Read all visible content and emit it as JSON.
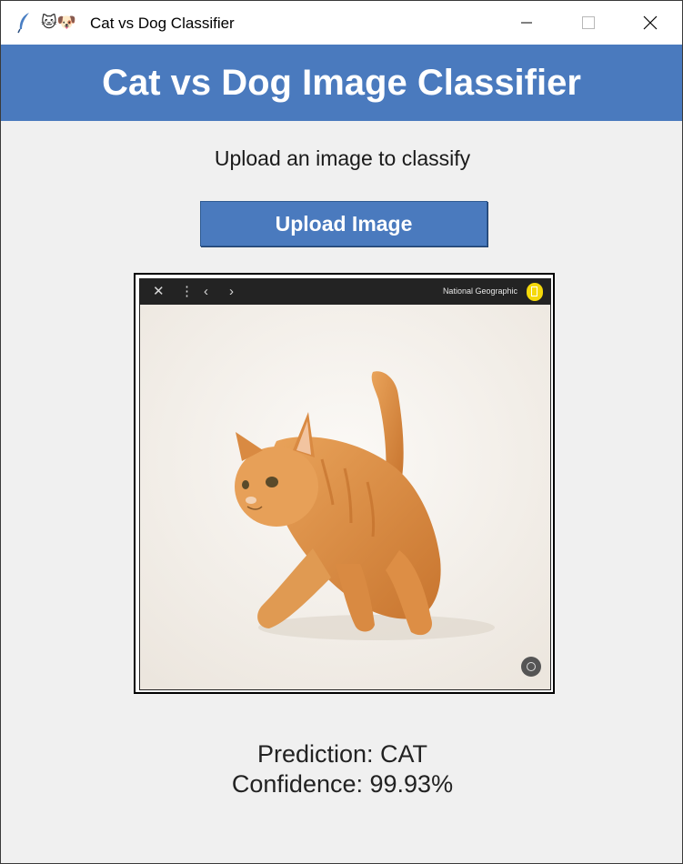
{
  "window": {
    "title": "Cat vs Dog Classifier",
    "title_icons": "🐱🐶"
  },
  "header": {
    "title": "Cat vs Dog Image Classifier",
    "background": "#4a7abe"
  },
  "main": {
    "instructions": "Upload an image to classify",
    "upload_button_label": "Upload Image",
    "image_viewer": {
      "source_label": "National Geographic"
    },
    "prediction_text": "Prediction: CAT",
    "confidence_text": "Confidence: 99.93%"
  }
}
